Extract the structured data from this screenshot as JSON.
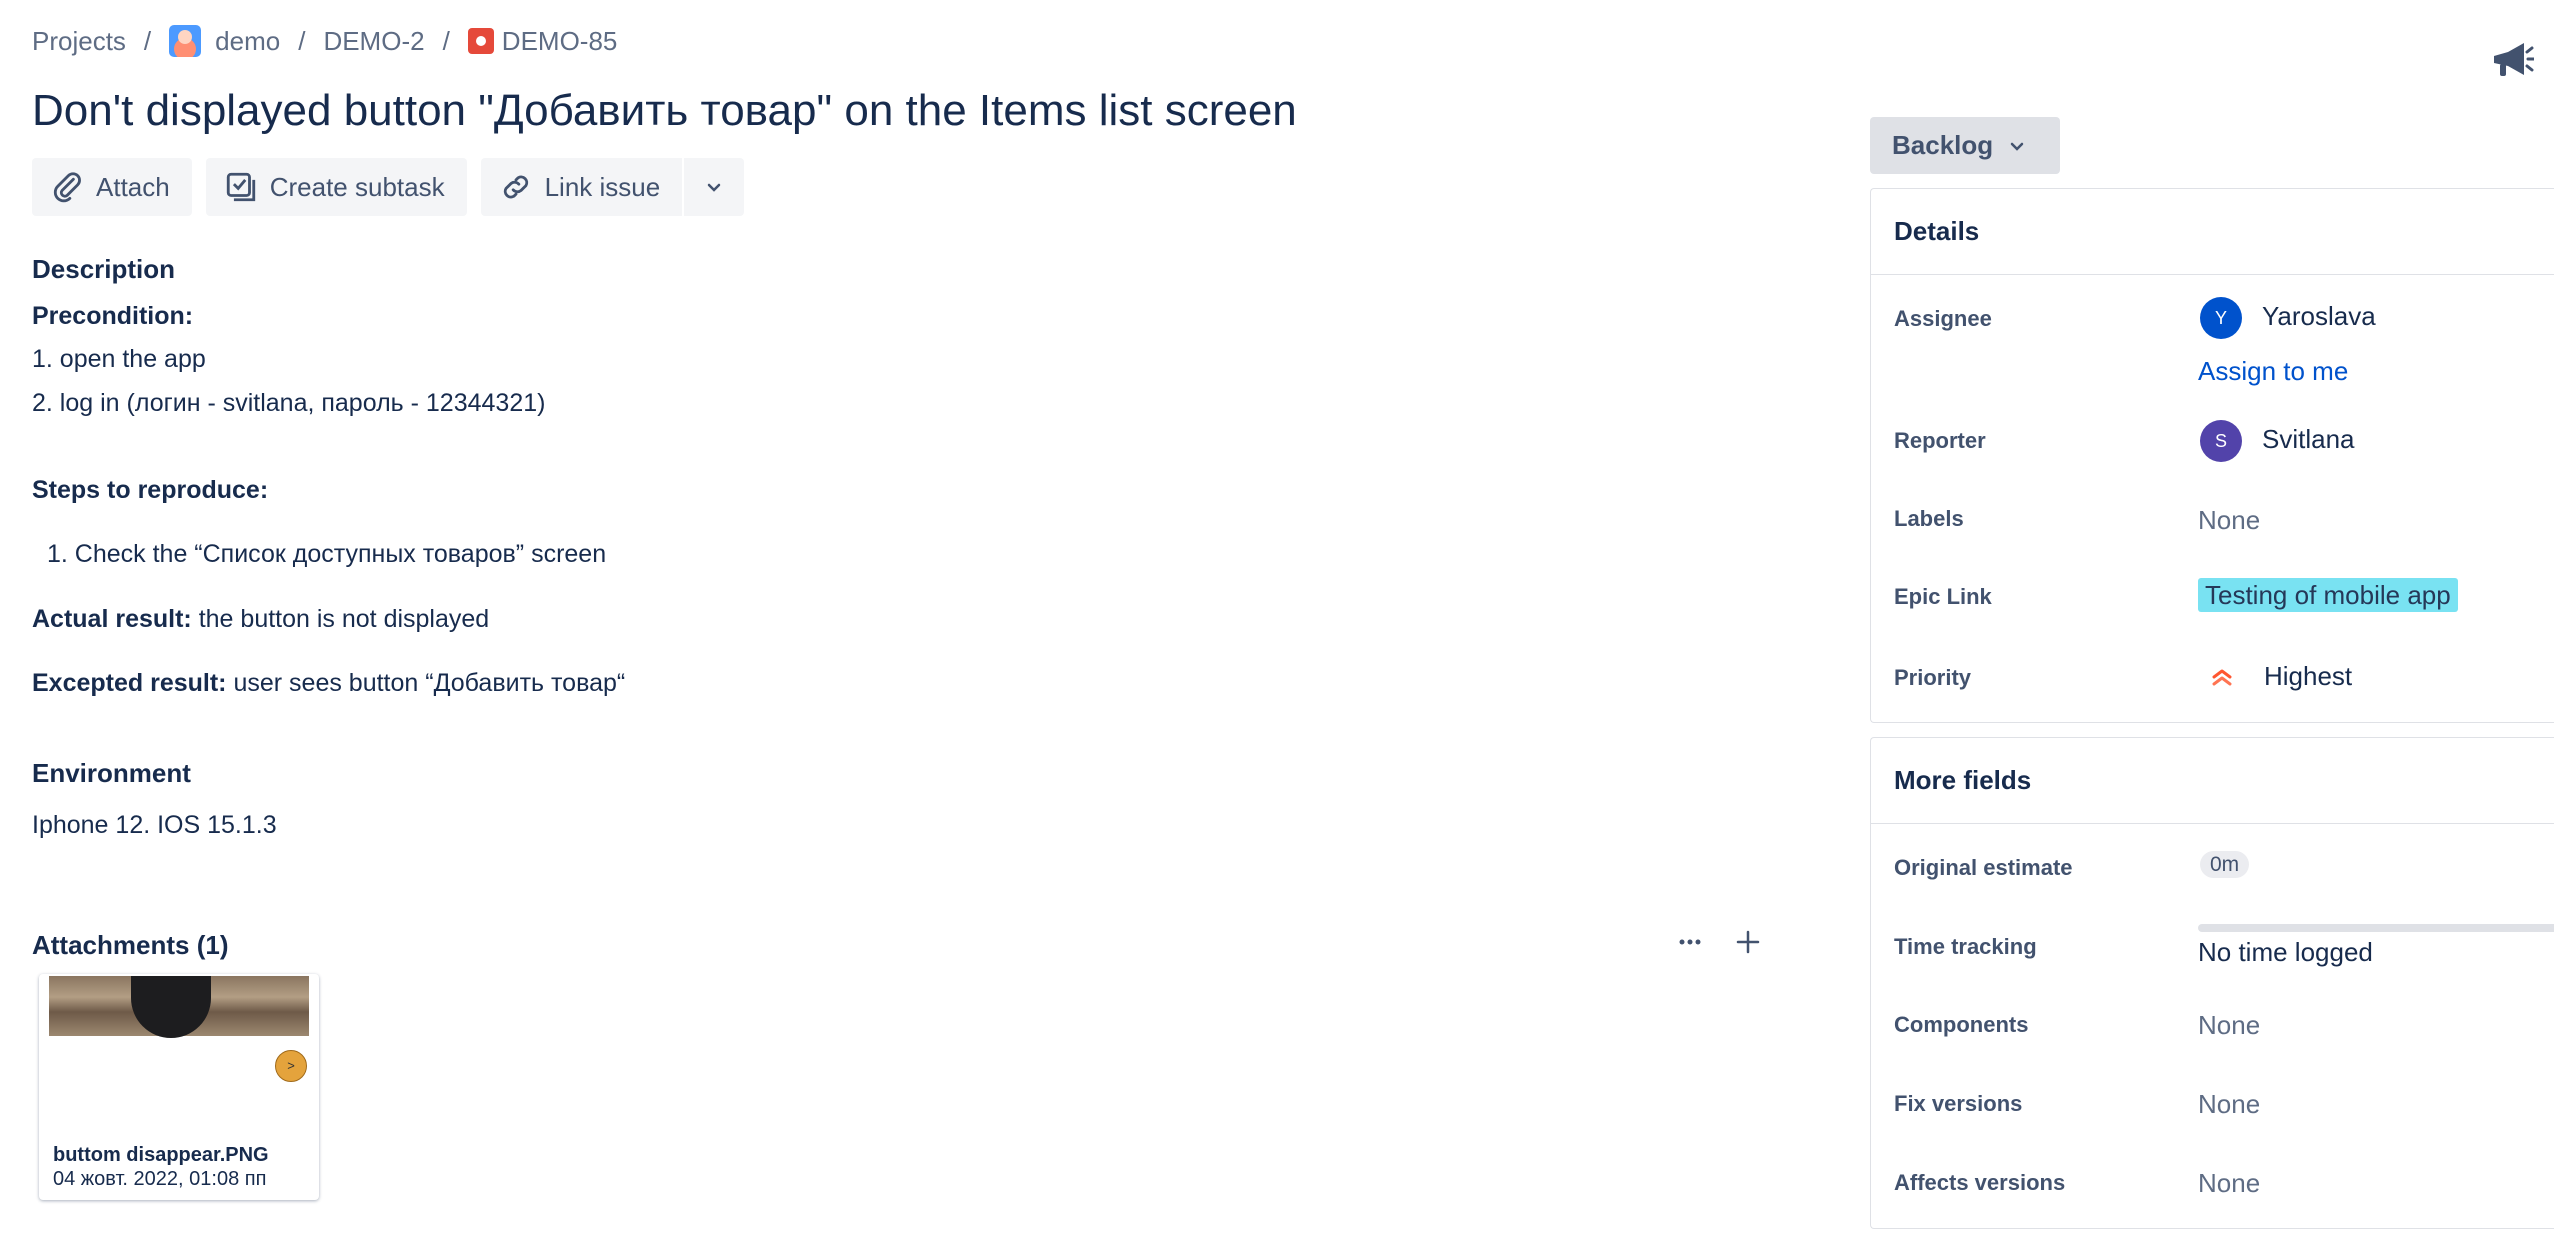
{
  "breadcrumb": {
    "projects": "Projects",
    "project": "demo",
    "epic": "DEMO-2",
    "issue": "DEMO-85",
    "separator": "/"
  },
  "issue": {
    "title": "Don't displayed button \"Добавить товар\" on the Items list screen"
  },
  "toolbar": {
    "attach": "Attach",
    "create_subtask": "Create subtask",
    "link_issue": "Link issue"
  },
  "description": {
    "heading": "Description",
    "precondition_label": "Precondition:",
    "precondition_1": "1. open the app",
    "precondition_2": "2. log in (логин - svitlana, пароль - 12344321)",
    "steps_label": "Steps to reproduce:",
    "step_1": "1. Check the “Список доступных товаров” screen",
    "actual_label": "Actual result:",
    "actual_text": " the button is not displayed",
    "expected_label": "Excepted result:",
    "expected_text": " user sees button “Добавить товар“"
  },
  "environment": {
    "heading": "Environment",
    "text": "Iphone 12.  IOS 15.1.3"
  },
  "attachments": {
    "heading": "Attachments (1)",
    "items": [
      {
        "name": "buttom disappear.PNG",
        "date": "04 жовт. 2022, 01:08 пп",
        "badge": ">"
      }
    ]
  },
  "status": {
    "label": "Backlog"
  },
  "details": {
    "heading": "Details",
    "assignee_label": "Assignee",
    "assignee_initial": "Y",
    "assignee_name": "Yaroslava",
    "assign_to_me": "Assign to me",
    "reporter_label": "Reporter",
    "reporter_initial": "S",
    "reporter_name": "Svitlana",
    "labels_label": "Labels",
    "labels_value": "None",
    "epic_label": "Epic Link",
    "epic_value": "Testing of mobile app",
    "priority_label": "Priority",
    "priority_value": "Highest"
  },
  "more_fields": {
    "heading": "More fields",
    "original_estimate_label": "Original estimate",
    "original_estimate_value": "0m",
    "time_tracking_label": "Time tracking",
    "time_tracking_value": "No time logged",
    "components_label": "Components",
    "components_value": "None",
    "fix_versions_label": "Fix versions",
    "fix_versions_value": "None",
    "affects_versions_label": "Affects versions",
    "affects_versions_value": "None"
  },
  "colors": {
    "link": "#0052cc",
    "epic_bg": "#79e2f2",
    "assignee_avatar": "#0052cc",
    "reporter_avatar": "#5243aa",
    "priority": "#ff5630",
    "bug": "#e5493a"
  },
  "icons": {
    "attach": "paperclip-icon",
    "subtask": "subtask-icon",
    "link": "link-icon",
    "priority": "priority-highest-icon",
    "feedback": "megaphone-icon"
  }
}
